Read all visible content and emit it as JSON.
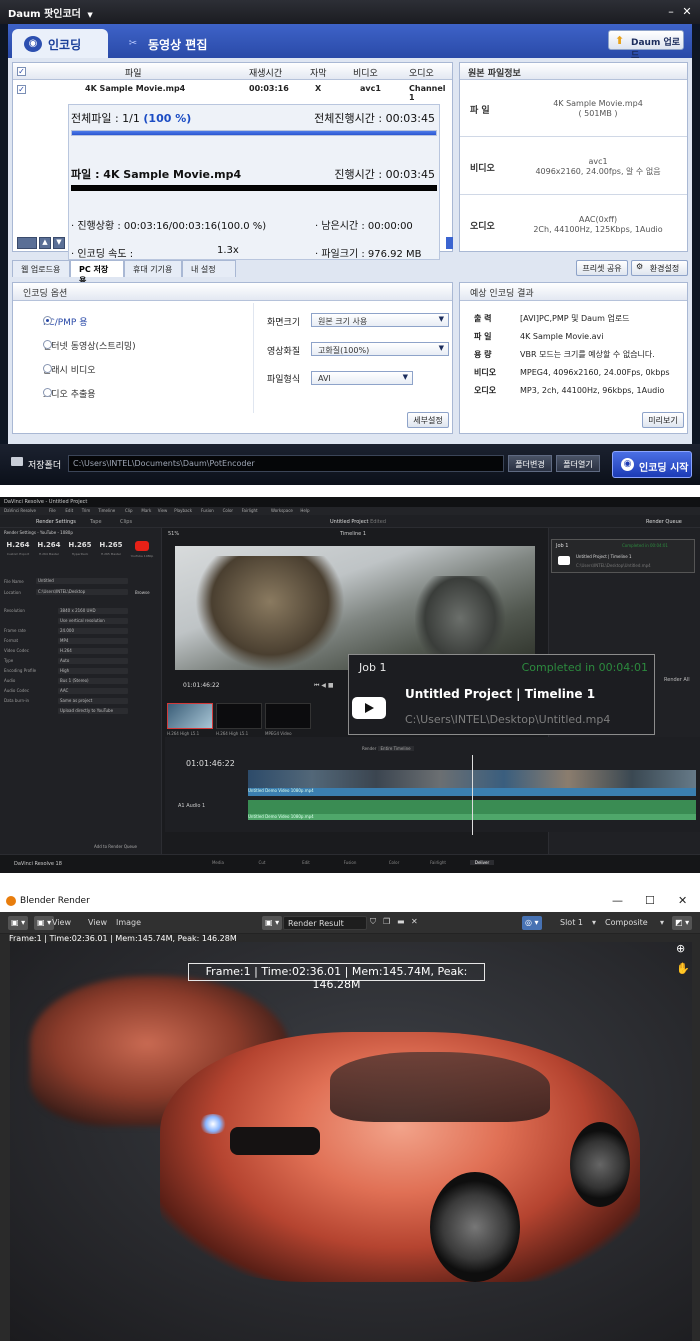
{
  "pot": {
    "title": "Daum 팟인코더",
    "tabs": [
      {
        "label": "인코딩",
        "icon": "film-reel-icon"
      },
      {
        "label": "동영상 편집",
        "icon": "clapper-icon"
      }
    ],
    "upload_button": "Daum 업로드",
    "table": {
      "headers": [
        "파일",
        "재생시간",
        "자막",
        "비디오",
        "오디오"
      ],
      "row": {
        "file": "4K Sample Movie.mp4",
        "duration": "00:03:16",
        "subtitle": "X",
        "video": "avc1",
        "audio": "Channel 1"
      }
    },
    "progress": {
      "total_files": "전체파일 : 1/1",
      "total_percent": "(100 %)",
      "total_elapsed": "전체진행시간 : 00:03:45",
      "file_label": "파일 : 4K Sample Movie.mp4",
      "file_elapsed": "진행시간 : 00:03:45",
      "status": "· 진행상황 : 00:03:16/00:03:16(100.0 %)",
      "remaining": "· 남은시간 : 00:00:00",
      "speed_label": "· 인코딩 속도 :",
      "speed_value": "1.3x",
      "filesize": "· 파일크기 : 976.92 MB",
      "total_fill": 1.0,
      "file_fill": 1.0
    },
    "source_info": {
      "title": "원본 파일정보",
      "rows": [
        {
          "key": "파 일",
          "value1": "4K Sample Movie.mp4",
          "value2": "( 501MB )"
        },
        {
          "key": "비디오",
          "value1": "avc1",
          "value2": "4096x2160, 24.00fps, 알 수 없음"
        },
        {
          "key": "오디오",
          "value1": "AAC(0xff)",
          "value2": "2Ch, 44100Hz, 125Kbps, 1Audio"
        }
      ]
    },
    "sub_tabs": [
      "웹 업로드용",
      "PC 저장용",
      "휴대 기기용",
      "내 설정"
    ],
    "preset_share": "프리셋 공유",
    "env_settings": "환경설정",
    "options": {
      "title": "인코딩 옵션",
      "radios": [
        "PC/PMP 용",
        "인터넷 동영상(스트리밍)",
        "플래시 비디오",
        "오디오 추출용"
      ],
      "screen_size_label": "화면크기",
      "screen_size_value": "원본 크기 사용",
      "quality_label": "영상화질",
      "quality_value": "고화질(100%)",
      "format_label": "파일형식",
      "format_value": "AVI",
      "detail_button": "세부설정"
    },
    "expected": {
      "title": "예상 인코딩 결과",
      "rows": [
        {
          "key": "출 력",
          "value": "[AVI]PC,PMP 및 Daum 업로드"
        },
        {
          "key": "파 일",
          "value": "4K Sample Movie.avi"
        },
        {
          "key": "용 량",
          "value": "VBR 모드는 크기를 예상할 수 없습니다."
        },
        {
          "key": "비디오",
          "value": "MPEG4, 4096x2160, 24.00Fps, 0kbps"
        },
        {
          "key": "오디오",
          "value": "MP3, 2ch, 44100Hz, 96kbps, 1Audio"
        }
      ],
      "preview_button": "미리보기"
    },
    "folder": {
      "label": "저장폴더",
      "path": "C:\\Users\\INTEL\\Documents\\Daum\\PotEncoder",
      "change_button": "폴더변경",
      "open_button": "폴더열기",
      "start_button": "인코딩 시작"
    }
  },
  "davinci": {
    "window_title": "DaVinci Resolve - Untitled Project",
    "menu": [
      "DaVinci Resolve",
      "File",
      "Edit",
      "Trim",
      "Timeline",
      "Clip",
      "Mark",
      "View",
      "Playback",
      "Fusion",
      "Color",
      "Fairlight",
      "Workspace",
      "Help"
    ],
    "project_title": "Untitled Project",
    "project_status": "Edited",
    "timeline_name": "Timeline 1",
    "render_settings_title": "Render Settings - YouTube - 1080p",
    "render_settings_tab": "Render Settings",
    "tape_tab": "Tape",
    "clips_tab": "Clips",
    "formats": [
      {
        "name": "H.264",
        "label": "Custom Export"
      },
      {
        "name": "H.264",
        "label": "H.264 Master"
      },
      {
        "name": "H.265",
        "label": "HyperDeck"
      },
      {
        "name": "H.265",
        "label": "H.265 Master"
      },
      {
        "name": "YT",
        "label": "YouTube 1080p"
      }
    ],
    "file_name_label": "File Name",
    "file_name_value": "Untitled",
    "location_label": "Location",
    "location_value": "C:\\Users\\INTEL\\Desktop",
    "browse": "Browse",
    "settings": [
      {
        "k": "Resolution",
        "v": "3840 x 2160 UHD"
      },
      {
        "k": "",
        "v": "Use vertical resolution"
      },
      {
        "k": "Frame rate",
        "v": "24.000"
      },
      {
        "k": "Format",
        "v": "MP4"
      },
      {
        "k": "Video Codec",
        "v": "H.264"
      },
      {
        "k": "Type",
        "v": "Auto"
      },
      {
        "k": "Encoding Profile",
        "v": "High"
      },
      {
        "k": "Audio",
        "v": "Bus 1 (Stereo)"
      },
      {
        "k": "Audio Codec",
        "v": "AAC"
      },
      {
        "k": "Data burn-in",
        "v": "Same as project"
      },
      {
        "k": "",
        "v": "Upload directly to YouTube"
      }
    ],
    "add_to_queue": "Add to Render Queue",
    "viewer_zoom": "51%",
    "timecode_top": "01:01:46:22",
    "render_queue_title": "Render Queue",
    "render_queue_job": {
      "job": "Job 1",
      "status": "Completed in 00:04:01",
      "title": "Untitled Project | Timeline 1",
      "path": "C:\\Users\\INTEL\\Desktop\\Untitled.mp4"
    },
    "popup": {
      "job": "Job 1",
      "status": "Completed in 00:04:01",
      "title": "Untitled Project | Timeline 1",
      "path": "C:\\Users\\INTEL\\Desktop\\Untitled.mp4"
    },
    "render_all": "Render All",
    "timeline_timecode": "01:01:46:22",
    "thumbs": [
      "H.264 High L5.1",
      "H.264 High L5.1",
      "MPEG4 Video"
    ],
    "render_label": "Render",
    "entire_timeline": "Entire Timeline",
    "audio_track": "Audio 1",
    "clip_name": "Untitled Demo Video 1080p.mp4",
    "bottom_tabs": [
      "Media",
      "Cut",
      "Edit",
      "Fusion",
      "Color",
      "Fairlight",
      "Deliver"
    ],
    "product": "DaVinci Resolve 18"
  },
  "blender": {
    "window_title": "Blender Render",
    "menu": [
      "View",
      "View",
      "Image"
    ],
    "render_result": "Render Result",
    "slot": "Slot 1",
    "composite": "Composite",
    "stats": "Frame:1 | Time:02:36.01 | Mem:145.74M, Peak: 146.28M",
    "stats_box": "Frame:1 | Time:02:36.01 | Mem:145.74M, Peak: 146.28M"
  }
}
